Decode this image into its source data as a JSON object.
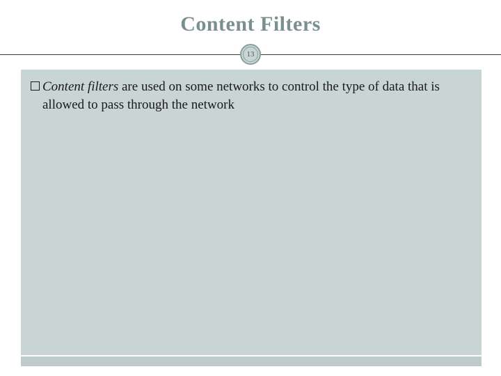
{
  "slide": {
    "title": "Content Filters",
    "page_number": "13",
    "bullet": {
      "term": "Content filters",
      "rest": " are used on some networks to control the type of data that is allowed to pass through the network"
    }
  },
  "colors": {
    "title": "#7a8f8f",
    "body_bg": "#c9d4d4",
    "accent": "#8aa0a0"
  }
}
